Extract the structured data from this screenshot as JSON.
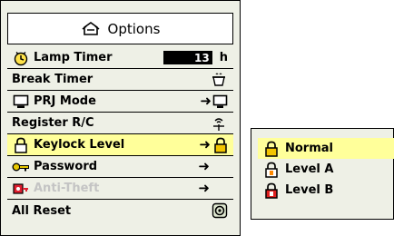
{
  "menu": {
    "title": "Options",
    "items": [
      {
        "label": "Lamp Timer",
        "value": "13",
        "unit": "h"
      },
      {
        "label": "Break Timer"
      },
      {
        "label": "PRJ Mode",
        "arrow": "➜"
      },
      {
        "label": "Register R/C"
      },
      {
        "label": "Keylock Level",
        "arrow": "➜"
      },
      {
        "label": "Password",
        "arrow": "➜"
      },
      {
        "label": "Anti-Theft",
        "arrow": "➜"
      },
      {
        "label": "All Reset"
      }
    ]
  },
  "submenu": {
    "items": [
      {
        "label": "Normal"
      },
      {
        "label": "Level A"
      },
      {
        "label": "Level B"
      }
    ]
  },
  "colors": {
    "highlight": "#ffff9a",
    "panel": "#eef0e6",
    "disabled_text": "#c4c4c4",
    "lock_yellow": "#f2c400",
    "lock_orange": "#ff8800",
    "lock_red": "#e02020",
    "key_yellow": "#e8c800",
    "antitheft_red": "#e02030"
  }
}
